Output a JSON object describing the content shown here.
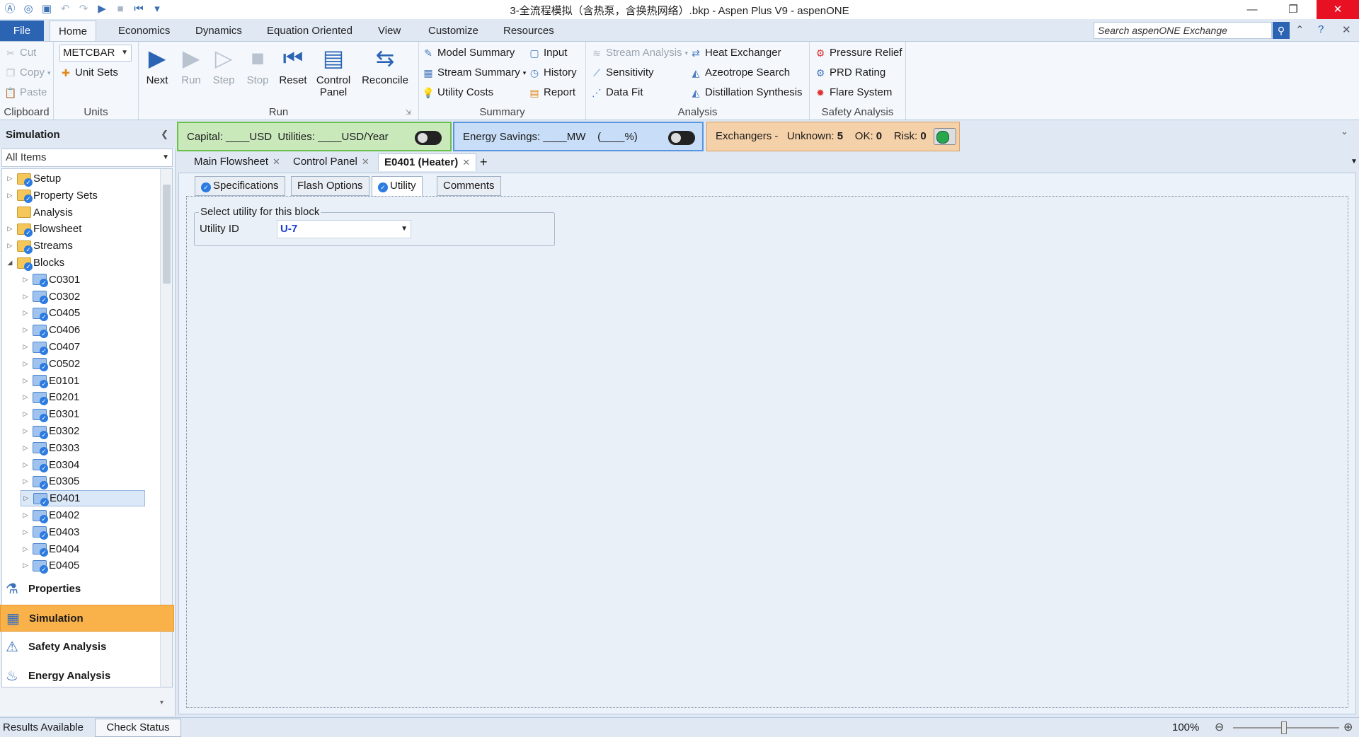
{
  "window": {
    "title": "3-全流程模拟（含热泵，含换热网络）.bkp - Aspen Plus V9 - aspenONE"
  },
  "ribbon_tabs": [
    "File",
    "Home",
    "Economics",
    "Dynamics",
    "Equation Oriented",
    "View",
    "Customize",
    "Resources"
  ],
  "search": {
    "placeholder": "Search aspenONE Exchange"
  },
  "clipboard": {
    "label": "Clipboard",
    "cut": "Cut",
    "copy": "Copy",
    "paste": "Paste"
  },
  "units": {
    "label": "Units",
    "selected": "METCBAR",
    "unit_sets": "Unit Sets"
  },
  "run": {
    "label": "Run",
    "next": "Next",
    "run": "Run",
    "step": "Step",
    "stop": "Stop",
    "reset": "Reset",
    "control_panel": "Control Panel",
    "reconcile": "Reconcile"
  },
  "summary": {
    "label": "Summary",
    "model_summary": "Model Summary",
    "stream_summary": "Stream Summary",
    "utility_costs": "Utility Costs",
    "input": "Input",
    "history": "History",
    "report": "Report"
  },
  "analysis": {
    "label": "Analysis",
    "stream_analysis": "Stream Analysis",
    "sensitivity": "Sensitivity",
    "data_fit": "Data Fit",
    "heat_exchanger": "Heat Exchanger",
    "azeotrope_search": "Azeotrope Search",
    "distillation_synthesis": "Distillation Synthesis"
  },
  "safety": {
    "label": "Safety Analysis",
    "pressure_relief": "Pressure Relief",
    "prd_rating": "PRD Rating",
    "flare_system": "Flare System"
  },
  "navigator": {
    "title": "Simulation",
    "filter": "All Items",
    "tree": [
      {
        "label": "Setup",
        "level": 0,
        "exp": "▷",
        "icon": "check"
      },
      {
        "label": "Property Sets",
        "level": 0,
        "exp": "▷",
        "icon": "check"
      },
      {
        "label": "Analysis",
        "level": 0,
        "exp": "",
        "icon": "folder"
      },
      {
        "label": "Flowsheet",
        "level": 0,
        "exp": "▷",
        "icon": "check"
      },
      {
        "label": "Streams",
        "level": 0,
        "exp": "▷",
        "icon": "check"
      },
      {
        "label": "Blocks",
        "level": 0,
        "exp": "◢",
        "icon": "check"
      },
      {
        "label": "C0301",
        "level": 1,
        "exp": "▷",
        "icon": "blue"
      },
      {
        "label": "C0302",
        "level": 1,
        "exp": "▷",
        "icon": "blue"
      },
      {
        "label": "C0405",
        "level": 1,
        "exp": "▷",
        "icon": "blue"
      },
      {
        "label": "C0406",
        "level": 1,
        "exp": "▷",
        "icon": "blue"
      },
      {
        "label": "C0407",
        "level": 1,
        "exp": "▷",
        "icon": "blue"
      },
      {
        "label": "C0502",
        "level": 1,
        "exp": "▷",
        "icon": "blue"
      },
      {
        "label": "E0101",
        "level": 1,
        "exp": "▷",
        "icon": "blue"
      },
      {
        "label": "E0201",
        "level": 1,
        "exp": "▷",
        "icon": "blue"
      },
      {
        "label": "E0301",
        "level": 1,
        "exp": "▷",
        "icon": "blue"
      },
      {
        "label": "E0302",
        "level": 1,
        "exp": "▷",
        "icon": "blue"
      },
      {
        "label": "E0303",
        "level": 1,
        "exp": "▷",
        "icon": "blue"
      },
      {
        "label": "E0304",
        "level": 1,
        "exp": "▷",
        "icon": "blue"
      },
      {
        "label": "E0305",
        "level": 1,
        "exp": "▷",
        "icon": "blue"
      },
      {
        "label": "E0401",
        "level": 1,
        "exp": "▷",
        "icon": "blue",
        "selected": true
      },
      {
        "label": "E0402",
        "level": 1,
        "exp": "▷",
        "icon": "blue"
      },
      {
        "label": "E0403",
        "level": 1,
        "exp": "▷",
        "icon": "blue"
      },
      {
        "label": "E0404",
        "level": 1,
        "exp": "▷",
        "icon": "blue"
      },
      {
        "label": "E0405",
        "level": 1,
        "exp": "▷",
        "icon": "blue"
      }
    ],
    "sections": [
      {
        "label": "Properties",
        "icon": "⚗",
        "active": false
      },
      {
        "label": "Simulation",
        "icon": "▦",
        "active": true
      },
      {
        "label": "Safety Analysis",
        "icon": "⚠",
        "active": false
      },
      {
        "label": "Energy Analysis",
        "icon": "♨",
        "active": false
      }
    ]
  },
  "dashboard": {
    "capital": "Capital: ____USD",
    "utilities": "Utilities: ____USD/Year",
    "energy_savings": "Energy Savings: ____MW",
    "energy_pct": "(____%)",
    "exchangers": "Exchangers -",
    "unknown_label": "Unknown:",
    "unknown_value": "5",
    "ok_label": "OK:",
    "ok_value": "0",
    "risk_label": "Risk:",
    "risk_value": "0"
  },
  "doc_tabs": [
    {
      "label": "Main Flowsheet",
      "active": false
    },
    {
      "label": "Control Panel",
      "active": false
    },
    {
      "label": "E0401 (Heater)",
      "active": true
    }
  ],
  "form_tabs": [
    {
      "label": "Specifications",
      "check": true,
      "active": false
    },
    {
      "label": "Flash Options",
      "check": false,
      "active": false
    },
    {
      "label": "Utility",
      "check": true,
      "active": true
    },
    {
      "label": "Comments",
      "check": false,
      "active": false
    }
  ],
  "form": {
    "legend": "Select utility for this block",
    "utility_label": "Utility ID",
    "utility_value": "U-7"
  },
  "status": {
    "text": "Results Available",
    "check_status": "Check Status",
    "zoom": "100%"
  }
}
